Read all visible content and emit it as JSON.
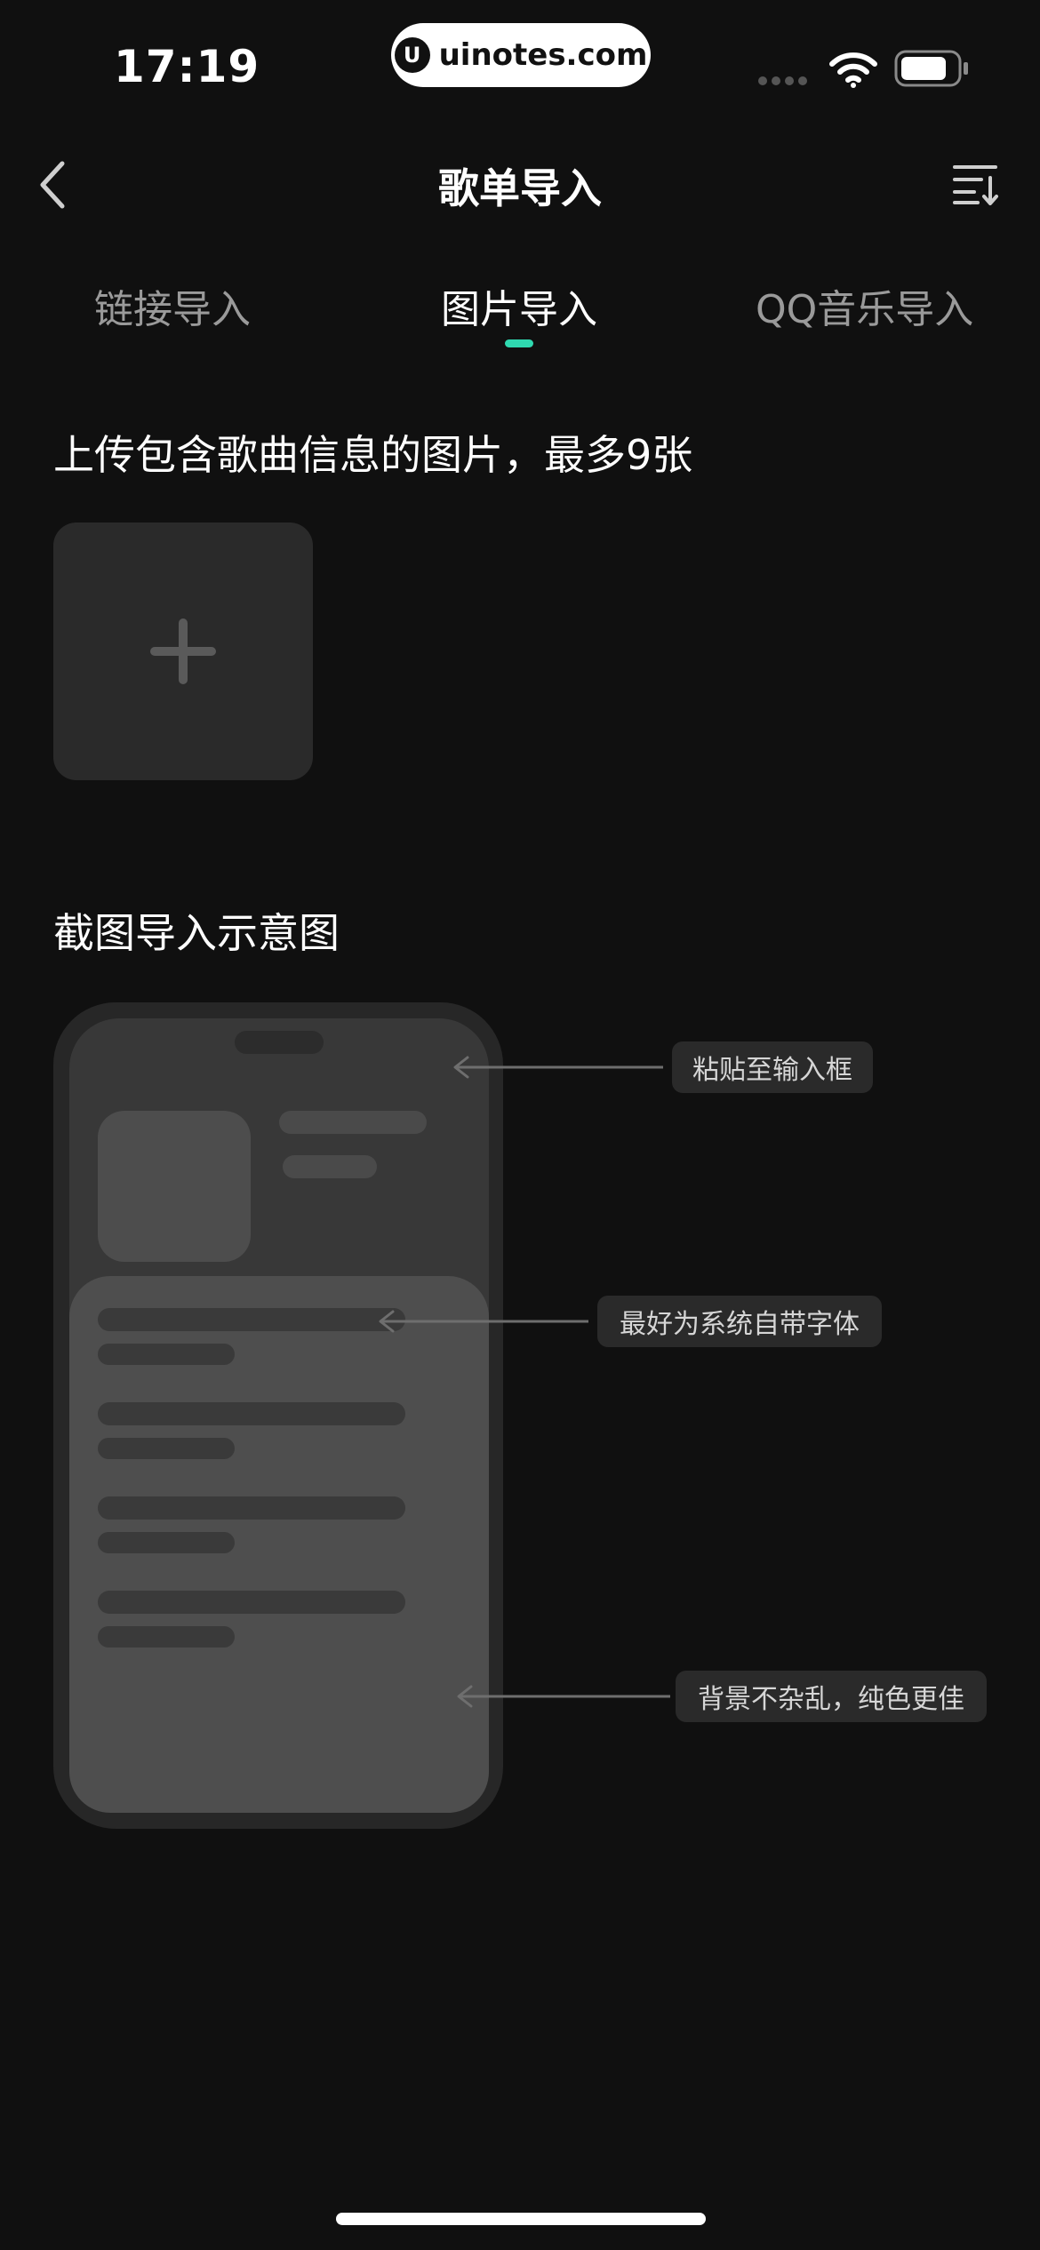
{
  "status_bar": {
    "time": "17:19",
    "watermark": "uinotes.com",
    "watermark_logo": "U"
  },
  "header": {
    "title": "歌单导入",
    "back_icon": "chevron-left-icon",
    "menu_icon": "sort-list-icon"
  },
  "tabs": [
    {
      "label": "链接导入",
      "active": false
    },
    {
      "label": "图片导入",
      "active": true
    },
    {
      "label": "QQ音乐导入",
      "active": false
    }
  ],
  "colors": {
    "accent": "#2fd9b0",
    "background": "#101010"
  },
  "upload": {
    "title": "上传包含歌曲信息的图片，最多9张",
    "add_icon": "plus-icon"
  },
  "example": {
    "title": "截图导入示意图",
    "callouts": [
      "粘贴至输入框",
      "最好为系统自带字体",
      "背景不杂乱，纯色更佳"
    ]
  }
}
